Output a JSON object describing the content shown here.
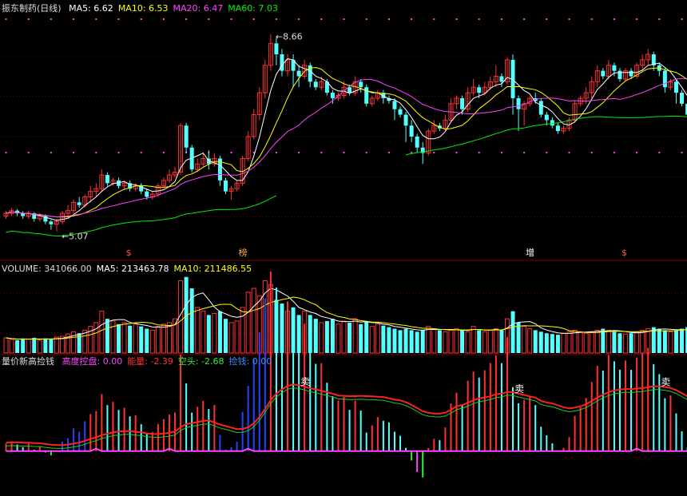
{
  "colors": {
    "bg": "#000000",
    "grid": "#7a0000",
    "up": "#ff3232",
    "down": "#54ffff",
    "ma5": "#ffffff",
    "ma10": "#ffff00",
    "ma20": "#ff44ff",
    "ma60": "#00ee00",
    "high_line": "#ff2020",
    "mid_line": "#22cc22",
    "low_line": "#ff44ff",
    "dot": "#ff44ff"
  },
  "price_panel": {
    "title": "振东制药(日线)",
    "indicators": [
      {
        "label": "MA5:",
        "value": "6.62",
        "color": "#ffffff"
      },
      {
        "label": "MA10:",
        "value": "6.53",
        "color": "#ffff00"
      },
      {
        "label": "MA20:",
        "value": "6.47",
        "color": "#ff44ff"
      },
      {
        "label": "MA60:",
        "value": "7.03",
        "color": "#00ee00"
      }
    ],
    "high_label": "8.66",
    "low_label": "5.07",
    "markers": [
      {
        "text": "$",
        "idx": 22,
        "color": "#ff5050"
      },
      {
        "text": "榜",
        "idx": 42,
        "color": "#ffaa44"
      },
      {
        "text": "增",
        "idx": 93,
        "color": "#ffffff"
      },
      {
        "text": "$",
        "idx": 110,
        "color": "#ff5050"
      }
    ]
  },
  "volume_panel": {
    "indicators": [
      {
        "label": "VOLUME:",
        "value": "341066.00",
        "color": "#dddddd"
      },
      {
        "label": "MA5:",
        "value": "213463.78",
        "color": "#ffffff"
      },
      {
        "label": "MA10:",
        "value": "211486.55",
        "color": "#ffff00"
      }
    ]
  },
  "signal_panel": {
    "title": "量价新高捡钱",
    "indicators": [
      {
        "label": "高度控盘:",
        "value": "0.00",
        "color": "#ff44ff"
      },
      {
        "label": "能量:",
        "value": "-2.39",
        "color": "#ff3333"
      },
      {
        "label": "空头:",
        "value": "-2.68",
        "color": "#33ee33"
      },
      {
        "label": "捡钱:",
        "value": "0.00",
        "color": "#4488ff"
      }
    ],
    "sell_labels": [
      {
        "text": "卖",
        "idx": 53
      },
      {
        "text": "卖",
        "idx": 91
      },
      {
        "text": "卖",
        "idx": 117
      }
    ]
  },
  "chart_data": {
    "type": "candlestick",
    "n": 122,
    "ylim": [
      4.6,
      9.0
    ],
    "candles": [
      [
        5.35,
        5.4,
        5.3,
        5.45
      ],
      [
        5.4,
        5.45,
        5.35,
        5.5
      ],
      [
        5.45,
        5.4,
        5.35,
        5.48
      ],
      [
        5.4,
        5.35,
        5.3,
        5.44
      ],
      [
        5.35,
        5.4,
        5.3,
        5.45
      ],
      [
        5.4,
        5.3,
        5.25,
        5.42
      ],
      [
        5.3,
        5.35,
        5.25,
        5.4
      ],
      [
        5.35,
        5.25,
        5.2,
        5.38
      ],
      [
        5.25,
        5.2,
        5.1,
        5.28
      ],
      [
        5.2,
        5.25,
        5.07,
        5.3
      ],
      [
        5.25,
        5.4,
        5.2,
        5.45
      ],
      [
        5.4,
        5.45,
        5.35,
        5.55
      ],
      [
        5.45,
        5.6,
        5.4,
        5.65
      ],
      [
        5.6,
        5.55,
        5.5,
        5.7
      ],
      [
        5.55,
        5.7,
        5.5,
        5.75
      ],
      [
        5.7,
        5.8,
        5.6,
        5.9
      ],
      [
        5.8,
        5.85,
        5.7,
        5.95
      ],
      [
        5.85,
        6.1,
        5.8,
        6.2
      ],
      [
        6.1,
        5.95,
        5.9,
        6.15
      ],
      [
        5.95,
        6.0,
        5.9,
        6.05
      ],
      [
        6.0,
        5.9,
        5.85,
        6.05
      ],
      [
        5.9,
        5.95,
        5.85,
        6.0
      ],
      [
        5.95,
        5.85,
        5.8,
        6.0
      ],
      [
        5.85,
        5.9,
        5.8,
        5.95
      ],
      [
        5.9,
        5.8,
        5.75,
        5.95
      ],
      [
        5.8,
        5.7,
        5.65,
        5.85
      ],
      [
        5.7,
        5.75,
        5.65,
        5.8
      ],
      [
        5.75,
        5.9,
        5.7,
        5.95
      ],
      [
        5.9,
        6.0,
        5.85,
        6.05
      ],
      [
        6.0,
        6.1,
        5.95,
        6.2
      ],
      [
        6.1,
        6.15,
        6.05,
        6.25
      ],
      [
        6.15,
        7.0,
        6.1,
        7.05
      ],
      [
        7.0,
        6.6,
        6.5,
        7.05
      ],
      [
        6.6,
        6.2,
        6.15,
        6.65
      ],
      [
        6.2,
        6.3,
        6.15,
        6.4
      ],
      [
        6.3,
        6.4,
        6.25,
        6.5
      ],
      [
        6.4,
        6.3,
        6.2,
        6.55
      ],
      [
        6.3,
        6.4,
        6.25,
        6.5
      ],
      [
        6.4,
        6.0,
        5.9,
        6.45
      ],
      [
        6.0,
        5.8,
        5.75,
        6.05
      ],
      [
        5.8,
        5.85,
        5.65,
        5.9
      ],
      [
        5.85,
        5.95,
        5.8,
        6.0
      ],
      [
        5.95,
        6.4,
        5.9,
        6.45
      ],
      [
        6.4,
        6.8,
        6.35,
        6.9
      ],
      [
        6.8,
        7.2,
        6.75,
        7.3
      ],
      [
        7.2,
        7.6,
        7.1,
        7.7
      ],
      [
        7.6,
        8.1,
        7.5,
        8.2
      ],
      [
        8.1,
        8.5,
        8.0,
        8.66
      ],
      [
        8.5,
        8.3,
        8.1,
        8.6
      ],
      [
        8.3,
        8.0,
        7.9,
        8.4
      ],
      [
        8.0,
        8.2,
        7.9,
        8.3
      ],
      [
        8.2,
        8.0,
        7.7,
        8.3
      ],
      [
        8.0,
        7.9,
        7.7,
        8.1
      ],
      [
        7.9,
        8.1,
        7.85,
        8.2
      ],
      [
        8.1,
        7.8,
        7.7,
        8.15
      ],
      [
        7.8,
        7.7,
        7.65,
        7.85
      ],
      [
        7.7,
        7.8,
        7.65,
        7.9
      ],
      [
        7.8,
        7.6,
        7.55,
        7.85
      ],
      [
        7.6,
        7.5,
        7.4,
        7.65
      ],
      [
        7.5,
        7.55,
        7.45,
        7.6
      ],
      [
        7.55,
        7.7,
        7.5,
        7.8
      ],
      [
        7.7,
        7.6,
        7.55,
        7.75
      ],
      [
        7.6,
        7.8,
        7.55,
        7.9
      ],
      [
        7.8,
        7.7,
        7.6,
        7.85
      ],
      [
        7.7,
        7.4,
        7.35,
        7.75
      ],
      [
        7.4,
        7.5,
        7.35,
        7.55
      ],
      [
        7.5,
        7.6,
        7.45,
        7.65
      ],
      [
        7.6,
        7.5,
        7.4,
        7.65
      ],
      [
        7.5,
        7.45,
        7.4,
        7.55
      ],
      [
        7.45,
        7.3,
        7.1,
        7.5
      ],
      [
        7.3,
        7.2,
        7.15,
        7.35
      ],
      [
        7.2,
        7.0,
        6.7,
        7.25
      ],
      [
        7.0,
        6.8,
        6.7,
        7.1
      ],
      [
        6.8,
        6.6,
        6.5,
        6.85
      ],
      [
        6.6,
        6.5,
        6.3,
        6.7
      ],
      [
        6.5,
        6.9,
        6.45,
        6.95
      ],
      [
        6.9,
        7.0,
        6.85,
        7.1
      ],
      [
        7.0,
        6.95,
        6.9,
        7.05
      ],
      [
        6.95,
        7.1,
        6.9,
        7.2
      ],
      [
        7.1,
        7.4,
        7.05,
        7.5
      ],
      [
        7.4,
        7.5,
        7.3,
        7.55
      ],
      [
        7.5,
        7.3,
        7.2,
        7.55
      ],
      [
        7.3,
        7.6,
        7.25,
        7.7
      ],
      [
        7.6,
        7.7,
        7.55,
        7.85
      ],
      [
        7.7,
        7.6,
        7.5,
        7.75
      ],
      [
        7.6,
        7.7,
        7.55,
        7.8
      ],
      [
        7.7,
        7.8,
        7.65,
        7.9
      ],
      [
        7.8,
        7.9,
        7.7,
        8.1
      ],
      [
        7.9,
        7.8,
        7.7,
        7.95
      ],
      [
        7.8,
        8.2,
        7.75,
        8.25
      ],
      [
        8.2,
        7.5,
        7.2,
        8.3
      ],
      [
        7.5,
        7.3,
        6.9,
        7.55
      ],
      [
        7.3,
        7.4,
        7.0,
        7.45
      ],
      [
        7.4,
        7.5,
        7.35,
        7.55
      ],
      [
        7.5,
        7.45,
        7.4,
        7.6
      ],
      [
        7.45,
        7.2,
        7.15,
        7.5
      ],
      [
        7.2,
        7.1,
        7.0,
        7.25
      ],
      [
        7.1,
        7.0,
        6.95,
        7.15
      ],
      [
        7.0,
        6.9,
        6.85,
        7.05
      ],
      [
        6.9,
        6.95,
        6.85,
        7.0
      ],
      [
        6.95,
        7.1,
        6.9,
        7.15
      ],
      [
        7.1,
        7.4,
        7.05,
        7.45
      ],
      [
        7.4,
        7.5,
        7.35,
        7.55
      ],
      [
        7.5,
        7.6,
        7.4,
        7.7
      ],
      [
        7.6,
        7.8,
        7.5,
        7.9
      ],
      [
        7.8,
        8.0,
        7.7,
        8.1
      ],
      [
        8.0,
        7.9,
        7.85,
        8.05
      ],
      [
        7.9,
        8.1,
        7.85,
        8.2
      ],
      [
        8.1,
        8.0,
        7.9,
        8.15
      ],
      [
        8.0,
        7.85,
        7.8,
        8.05
      ],
      [
        7.85,
        8.0,
        7.8,
        8.05
      ],
      [
        8.0,
        7.9,
        7.85,
        8.05
      ],
      [
        7.9,
        8.1,
        7.85,
        8.15
      ],
      [
        8.1,
        8.2,
        8.0,
        8.3
      ],
      [
        8.2,
        8.3,
        8.1,
        8.4
      ],
      [
        8.3,
        8.1,
        8.0,
        8.35
      ],
      [
        8.1,
        8.0,
        7.9,
        8.15
      ],
      [
        8.0,
        7.7,
        7.6,
        8.05
      ],
      [
        7.7,
        7.8,
        7.65,
        7.85
      ],
      [
        7.8,
        7.6,
        7.4,
        7.85
      ],
      [
        7.6,
        7.4,
        7.35,
        7.65
      ],
      [
        7.4,
        7.2,
        7.1,
        7.45
      ]
    ],
    "volumes": [
      0.2,
      0.18,
      0.17,
      0.19,
      0.18,
      0.2,
      0.17,
      0.19,
      0.18,
      0.21,
      0.22,
      0.25,
      0.28,
      0.26,
      0.3,
      0.35,
      0.4,
      0.55,
      0.45,
      0.42,
      0.38,
      0.4,
      0.36,
      0.38,
      0.35,
      0.32,
      0.3,
      0.35,
      0.38,
      0.4,
      0.45,
      0.95,
      1.0,
      0.85,
      0.6,
      0.55,
      0.5,
      0.52,
      0.55,
      0.45,
      0.4,
      0.42,
      0.6,
      0.8,
      0.85,
      0.75,
      0.95,
      0.9,
      0.7,
      0.65,
      0.55,
      0.6,
      0.5,
      0.55,
      0.5,
      0.45,
      0.4,
      0.42,
      0.45,
      0.38,
      0.42,
      0.4,
      0.45,
      0.38,
      0.42,
      0.35,
      0.38,
      0.36,
      0.34,
      0.32,
      0.3,
      0.32,
      0.3,
      0.28,
      0.3,
      0.35,
      0.32,
      0.3,
      0.28,
      0.3,
      0.32,
      0.3,
      0.28,
      0.35,
      0.3,
      0.28,
      0.3,
      0.32,
      0.3,
      0.45,
      0.55,
      0.4,
      0.35,
      0.32,
      0.3,
      0.28,
      0.26,
      0.25,
      0.24,
      0.26,
      0.28,
      0.3,
      0.28,
      0.26,
      0.28,
      0.3,
      0.32,
      0.3,
      0.28,
      0.26,
      0.25,
      0.26,
      0.28,
      0.3,
      0.32,
      0.34,
      0.32,
      0.3,
      0.28,
      0.3,
      0.32,
      0.34
    ],
    "vol_ylim": [
      0,
      1.05
    ],
    "ma60_range": [
      0,
      48
    ],
    "ma60_gap": [
      49,
      71
    ],
    "sig_ylim": [
      -0.45,
      1.0
    ]
  }
}
